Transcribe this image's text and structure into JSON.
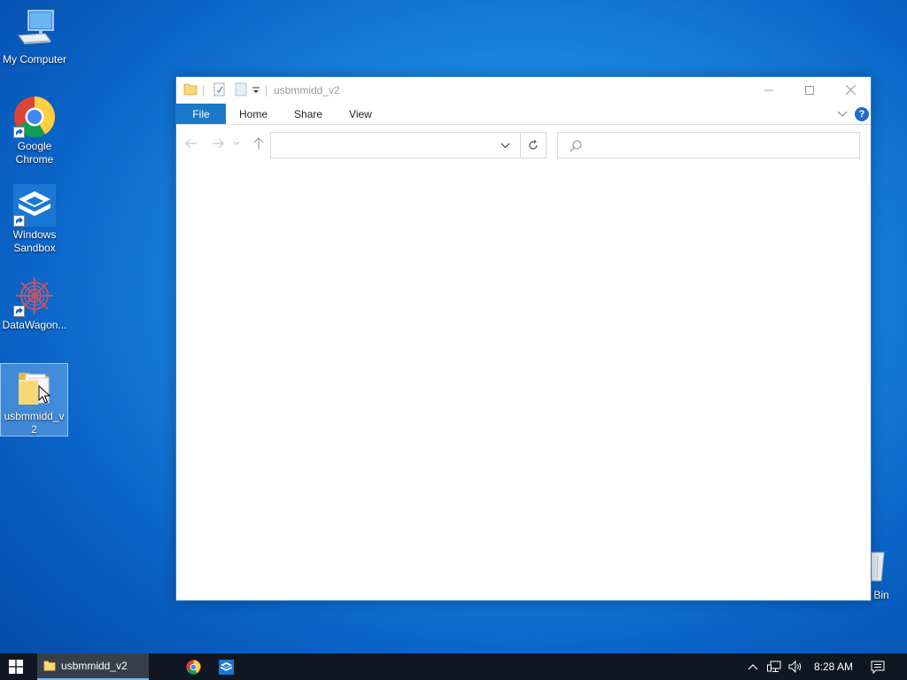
{
  "desktop": {
    "icons": [
      {
        "label": "My Computer"
      },
      {
        "label": "Google Chrome"
      },
      {
        "label": "Windows Sandbox"
      },
      {
        "label": "DataWagon..."
      },
      {
        "label": "usbmmidd_v2"
      }
    ],
    "recycle_bin_visible_label": "e Bin"
  },
  "explorer": {
    "title": "usbmmidd_v2",
    "ribbon_tabs": [
      "File",
      "Home",
      "Share",
      "View"
    ],
    "address_value": "",
    "search_placeholder": ""
  },
  "taskbar": {
    "active_window_label": "usbmmidd_v2",
    "clock": "8:28 AM"
  },
  "colors": {
    "accent": "#1979ca",
    "taskbar": "#101722",
    "folder": "#f8d775"
  },
  "icons": [
    "computer-icon",
    "chrome-icon",
    "sandbox-icon",
    "datawagon-icon",
    "folder-icon",
    "recycle-bin-icon",
    "windows-start-icon",
    "network-icon",
    "volume-icon",
    "notification-icon"
  ]
}
